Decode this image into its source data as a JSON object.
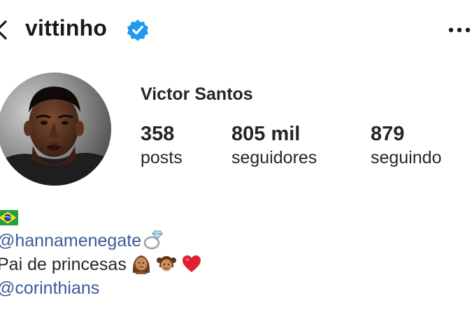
{
  "header": {
    "username": "vittinho",
    "verified_icon": "verified-badge-icon",
    "back_icon": "back-chevron-icon",
    "more_icon": "more-options-icon"
  },
  "profile": {
    "full_name": "Victor Santos",
    "avatar_icon": "profile-photo",
    "stats": {
      "posts": {
        "value": "358",
        "label": "posts"
      },
      "followers": {
        "value": "805 mil",
        "label": "seguidores"
      },
      "following": {
        "value": "879",
        "label": "seguindo"
      }
    }
  },
  "bio": {
    "flag_icon": "brazil-flag-icon",
    "mention_1": "@hannamenegate",
    "mention_1_icon": "ring-icon",
    "text": "Pai de princesas",
    "text_icons": [
      "woman-emoji-icon",
      "girl-emoji-icon",
      "red-heart-icon"
    ],
    "mention_2": "@corinthians"
  },
  "colors": {
    "text": "#262626",
    "mention": "#3b5b9a",
    "verified_blue": "#1d9bf0",
    "flag_green": "#229e45",
    "flag_yellow": "#f8e509",
    "flag_blue": "#2b49a3",
    "heart_red": "#e0202f"
  }
}
